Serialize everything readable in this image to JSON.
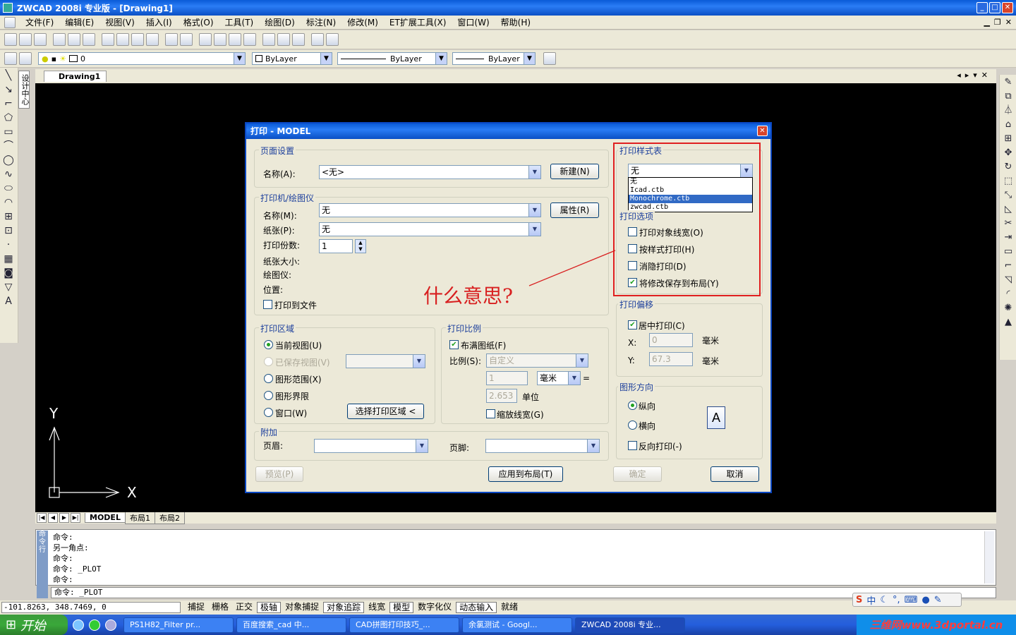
{
  "window": {
    "title": "ZWCAD 2008i 专业版 - [Drawing1]"
  },
  "menu": [
    "文件(F)",
    "编辑(E)",
    "视图(V)",
    "插入(I)",
    "格式(O)",
    "工具(T)",
    "绘图(D)",
    "标注(N)",
    "修改(M)",
    "ET扩展工具(X)",
    "窗口(W)",
    "帮助(H)"
  ],
  "layers": {
    "layer_name": "0",
    "color": "ByLayer",
    "linetype": "ByLayer",
    "lineweight": "ByLayer"
  },
  "design_center": "设计中心",
  "doc_tab": "Drawing1",
  "ucs": {
    "x": "X",
    "y": "Y"
  },
  "layout_tabs": [
    "MODEL",
    "布局1",
    "布局2"
  ],
  "command": {
    "side_label": "命令行",
    "lines": [
      "命令:",
      "另一角点:",
      "命令:",
      "命令: _PLOT",
      "命令:"
    ],
    "input": "命令: _PLOT"
  },
  "status": {
    "coords": "-101.8263,  348.7469,  0",
    "buttons": [
      "捕捉",
      "栅格",
      "正交",
      "极轴",
      "对象捕捉",
      "对象追踪",
      "线宽",
      "模型",
      "数字化仪",
      "动态输入",
      "就绪"
    ]
  },
  "taskbar": {
    "start": "开始",
    "tasks": [
      "PS1H82_Filter pr...",
      "百度搜索_cad 中...",
      "CAD拼图打印技巧_...",
      "余氯测试 - Googl...",
      "ZWCAD 2008i 专业..."
    ],
    "watermark": "三维网www.3dportal.cn"
  },
  "dialog": {
    "title": "打印 - MODEL",
    "page_setup": {
      "title": "页面设置",
      "name_label": "名称(A):",
      "name_value": "<无>",
      "new_button": "新建(N)"
    },
    "printer": {
      "title": "打印机/绘图仪",
      "name_label": "名称(M):",
      "name_value": "无",
      "paper_label": "纸张(P):",
      "paper_value": "无",
      "copies_label": "打印份数:",
      "copies_value": "1",
      "paper_size_label": "纸张大小:",
      "plotter_label": "绘图仪:",
      "location_label": "位置:",
      "properties_button": "属性(R)",
      "to_file": "打印到文件"
    },
    "plot_area": {
      "title": "打印区域",
      "options": [
        "当前视图(U)",
        "已保存视图(V)",
        "图形范围(X)",
        "图形界限",
        "窗口(W)"
      ],
      "select_button": "选择打印区域 <"
    },
    "scale": {
      "title": "打印比例",
      "fit": "布满图纸(F)",
      "scale_label": "比例(S):",
      "scale_value": "自定义",
      "value1": "1",
      "unit_value": "毫米",
      "equals": "=",
      "value2": "2.653",
      "unit_label": "单位",
      "lineweights": "缩放线宽(G)"
    },
    "extra": {
      "title": "附加",
      "header_label": "页眉:",
      "footer_label": "页脚:"
    },
    "style_table": {
      "title": "打印样式表",
      "value": "无",
      "options": [
        "无",
        "Icad.ctb",
        "Monochrome.ctb",
        "zwcad.ctb"
      ],
      "selected_index": 2
    },
    "plot_options": {
      "title": "打印选项",
      "items": [
        "打印对象线宽(O)",
        "按样式打印(H)",
        "消隐打印(D)",
        "将修改保存到布局(Y)"
      ],
      "checked": [
        false,
        false,
        false,
        true
      ]
    },
    "offset": {
      "title": "打印偏移",
      "center": "居中打印(C)",
      "x_label": "X:",
      "x_value": "0",
      "x_unit": "毫米",
      "y_label": "Y:",
      "y_value": "67.3",
      "y_unit": "毫米"
    },
    "orientation": {
      "title": "图形方向",
      "portrait": "纵向",
      "landscape": "横向",
      "reverse": "反向打印(-)",
      "icon_letter": "A"
    },
    "buttons": {
      "preview": "预览(P)",
      "apply": "应用到布局(T)",
      "ok": "确定",
      "cancel": "取消"
    }
  },
  "annotation": "什么意思?"
}
